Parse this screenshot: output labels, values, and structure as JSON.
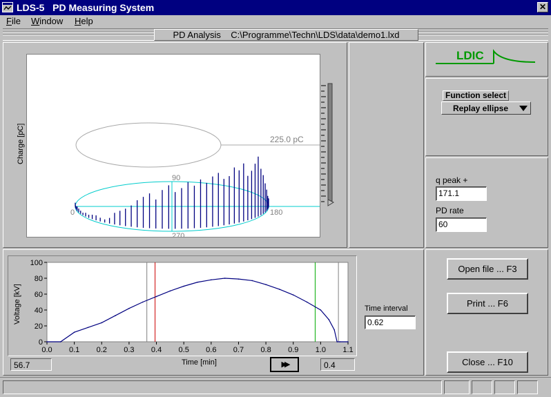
{
  "window": {
    "title": "LDS-5   PD Measuring System",
    "close_glyph": "✕"
  },
  "menu": {
    "file_first": "F",
    "file_rest": "ile",
    "window_first": "W",
    "window_rest": "indow",
    "help_first": "H",
    "help_rest": "elp"
  },
  "header": {
    "caption": "PD Analysis    C:\\Programme\\Techn\\LDS\\data\\demo1.lxd"
  },
  "logo": {
    "text": "LDIC",
    "color": "#009900"
  },
  "function_select": {
    "label": "Function select",
    "value": "Replay ellipse"
  },
  "measurements": {
    "qpeak_label": "q peak +",
    "qpeak_value": "171.1",
    "pdrate_label": "PD rate",
    "pdrate_value": "60"
  },
  "ellipse_plot": {
    "ylabel": "Charge [pC]",
    "ref_label": "225.0 pC",
    "phase_labels": {
      "p0": "0",
      "p90": "90",
      "p180": "180",
      "p270": "270"
    },
    "colors": {
      "ellipse": "#00cccc",
      "pulses": "#000080",
      "ref_ellipse": "#a8a8a8"
    }
  },
  "voltage_plot": {
    "ylabel": "Voltage [kV]",
    "xlabel": "Time [min]",
    "y_ticks": [
      "0",
      "20",
      "40",
      "60",
      "80",
      "100"
    ],
    "x_ticks": [
      "0.0",
      "0.1",
      "0.2",
      "0.3",
      "0.4",
      "0.5",
      "0.6",
      "0.7",
      "0.8",
      "0.9",
      "1.0",
      "1.1"
    ],
    "left_readout": "56.7",
    "right_readout": "0.4",
    "ff_glyph": "▶▶"
  },
  "chart_data": {
    "type": "line",
    "xlabel": "Time [min]",
    "ylabel": "Voltage [kV]",
    "xlim": [
      0,
      1.1
    ],
    "ylim": [
      0,
      100
    ],
    "x": [
      0.0,
      0.05,
      0.1,
      0.15,
      0.2,
      0.25,
      0.3,
      0.35,
      0.4,
      0.45,
      0.5,
      0.55,
      0.6,
      0.65,
      0.7,
      0.75,
      0.8,
      0.85,
      0.9,
      0.95,
      1.0,
      1.03,
      1.05,
      1.06,
      1.07,
      1.1
    ],
    "values": [
      0,
      0,
      12,
      18,
      24,
      33,
      42,
      50,
      57,
      64,
      70,
      75,
      78,
      80,
      79,
      77,
      72,
      66,
      59,
      50,
      40,
      28,
      15,
      0,
      0,
      0
    ],
    "markers": [
      {
        "x": 0.365,
        "color": "#808080"
      },
      {
        "x": 0.395,
        "color": "#cc0000"
      },
      {
        "x": 0.98,
        "color": "#00aa00"
      },
      {
        "x": 1.065,
        "color": "#808080"
      }
    ],
    "line_color": "#000080"
  },
  "time_interval": {
    "label": "Time interval",
    "value": "0.62"
  },
  "buttons": {
    "open": "Open file ... F3",
    "print": "Print ... F6",
    "close": "Close ... F10"
  }
}
